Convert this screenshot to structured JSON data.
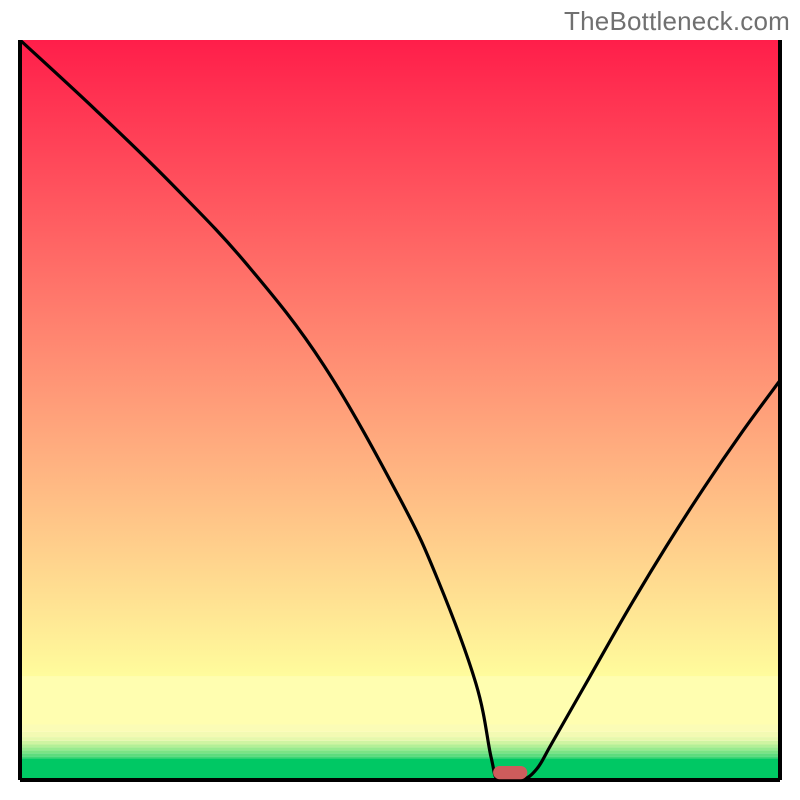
{
  "watermark": "TheBottleneck.com",
  "chart_data": {
    "type": "line",
    "title": "",
    "xlabel": "",
    "ylabel": "",
    "xlim": [
      0,
      100
    ],
    "ylim": [
      0,
      100
    ],
    "series": [
      {
        "name": "bottleneck-curve",
        "x": [
          0,
          10,
          20,
          30,
          40,
          50,
          55,
          60,
          62,
          63,
          66,
          68,
          70,
          75,
          80,
          85,
          90,
          95,
          100
        ],
        "values": [
          100,
          90.5,
          80.5,
          69.5,
          56,
          38,
          27,
          13,
          3,
          0,
          0,
          1.5,
          5,
          14,
          23,
          31.5,
          39.5,
          47,
          54
        ]
      }
    ],
    "marker": {
      "name": "bottleneck-point",
      "x": 64.5,
      "y": 1,
      "color": "#cd5c5c",
      "width_frac": 0.045,
      "height_frac": 0.018
    },
    "background_bands": [
      {
        "from": 0,
        "to": 0.029,
        "color": "#00c864"
      },
      {
        "from": 0.029,
        "to": 0.032,
        "color": "#3fd574"
      },
      {
        "from": 0.032,
        "to": 0.036,
        "color": "#5edc7d"
      },
      {
        "from": 0.036,
        "to": 0.04,
        "color": "#7be385"
      },
      {
        "from": 0.04,
        "to": 0.044,
        "color": "#98ea8f"
      },
      {
        "from": 0.044,
        "to": 0.048,
        "color": "#b3ef97"
      },
      {
        "from": 0.048,
        "to": 0.053,
        "color": "#cff4a2"
      },
      {
        "from": 0.053,
        "to": 0.058,
        "color": "#e6f8ac"
      },
      {
        "from": 0.058,
        "to": 0.065,
        "color": "#f3fab3"
      },
      {
        "from": 0.065,
        "to": 0.075,
        "color": "#fbfcb6"
      },
      {
        "from": 0.075,
        "to": 0.14,
        "color": "#fffeb0"
      },
      {
        "from": 0.14,
        "to": 1.0,
        "gradient": [
          "#fffc9c",
          "#ff1e4a"
        ]
      }
    ],
    "axes_color": "#000000"
  }
}
